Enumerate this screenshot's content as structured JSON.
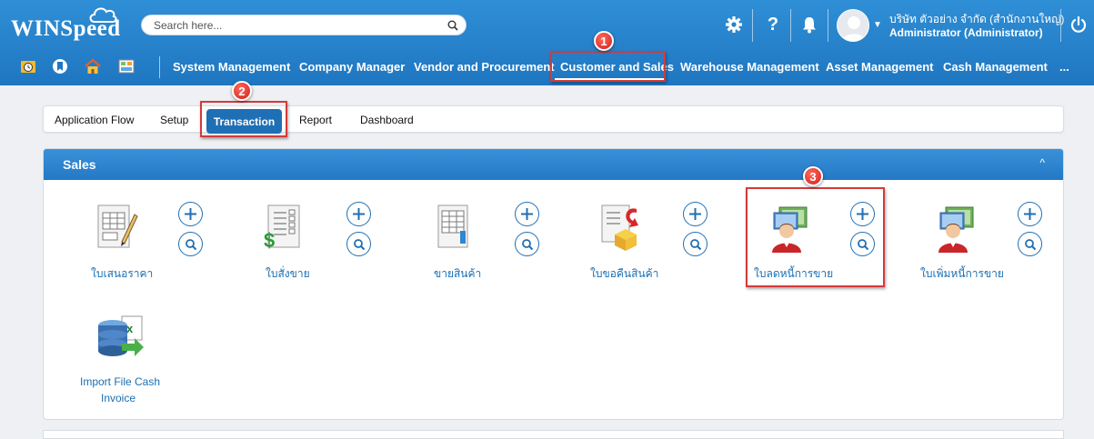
{
  "app": {
    "name": "WINSpeed"
  },
  "search": {
    "placeholder": "Search here..."
  },
  "user": {
    "company": "บริษัท ตัวอย่าง จำกัด (สำนักงานใหญ่)",
    "role": "Administrator (Administrator)"
  },
  "header_icons": [
    "gear-icon",
    "help-icon",
    "bell-icon",
    "power-icon"
  ],
  "help_label": "?",
  "quick_icons": [
    "clock-folder-icon",
    "bookmark-icon",
    "home-icon",
    "dashboard-icon"
  ],
  "nav": {
    "items": [
      {
        "label": "System Management"
      },
      {
        "label": "Company Manager"
      },
      {
        "label": "Vendor and Procurement"
      },
      {
        "label": "Customer and Sales"
      },
      {
        "label": "Warehouse Management"
      },
      {
        "label": "Asset Management"
      },
      {
        "label": "Cash Management"
      },
      {
        "label": "..."
      }
    ],
    "active": "Customer and Sales"
  },
  "tabs": {
    "items": [
      {
        "label": "Application Flow"
      },
      {
        "label": "Setup"
      },
      {
        "label": "Transaction"
      },
      {
        "label": "Report"
      },
      {
        "label": "Dashboard"
      }
    ],
    "active": "Transaction"
  },
  "steps": [
    "1",
    "2",
    "3"
  ],
  "panel": {
    "title": "Sales",
    "collapse": "^",
    "items": [
      {
        "label": "ใบเสนอราคา",
        "icon": "quotation-icon"
      },
      {
        "label": "ใบสั่งขาย",
        "icon": "sales-order-icon"
      },
      {
        "label": "ขายสินค้า",
        "icon": "sale-invoice-icon"
      },
      {
        "label": "ใบขอคืนสินค้า",
        "icon": "return-request-icon"
      },
      {
        "label": "ใบลดหนี้การขาย",
        "icon": "credit-note-icon"
      },
      {
        "label": "ใบเพิ่มหนี้การขาย",
        "icon": "debit-note-icon"
      }
    ],
    "import": {
      "label_line1": "Import File Cash",
      "label_line2": "Invoice",
      "icon": "import-excel-icon"
    }
  },
  "colors": {
    "header": "#1f76c0",
    "active_tab": "#1f6fb5",
    "link": "#1a6fb3",
    "callout": "#d33a3a"
  }
}
